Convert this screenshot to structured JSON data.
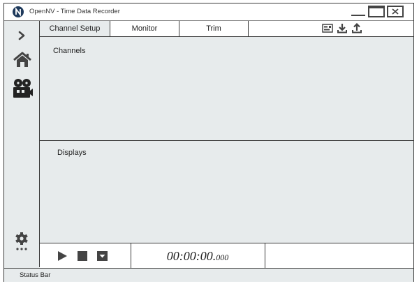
{
  "window": {
    "title": "OpenNV - Time Data Recorder",
    "logo_icon": "opennv-logo-icon"
  },
  "sidebar": {
    "items": [
      {
        "icon": "chevron-right-icon"
      },
      {
        "icon": "home-icon"
      },
      {
        "icon": "film-projector-icon"
      },
      {
        "icon": "settings-gear-icon"
      }
    ]
  },
  "tabs": [
    {
      "label": "Channel Setup",
      "active": true
    },
    {
      "label": "Monitor",
      "active": false
    },
    {
      "label": "Trim",
      "active": false
    }
  ],
  "toolbar": {
    "icons": [
      "settings-panel-icon",
      "download-icon",
      "upload-icon"
    ]
  },
  "panels": {
    "channels_label": "Channels",
    "displays_label": "Displays"
  },
  "transport": {
    "time_main": "00:00:00.",
    "time_ms": "000",
    "icons": [
      "play-icon",
      "stop-icon",
      "dropdown-icon"
    ]
  },
  "status_bar": {
    "text": "Status Bar"
  },
  "colors": {
    "panel_bg": "#e7ebec",
    "border": "#3a3a3a",
    "icon": "#444444",
    "logo_bg": "#1f3a5c"
  }
}
